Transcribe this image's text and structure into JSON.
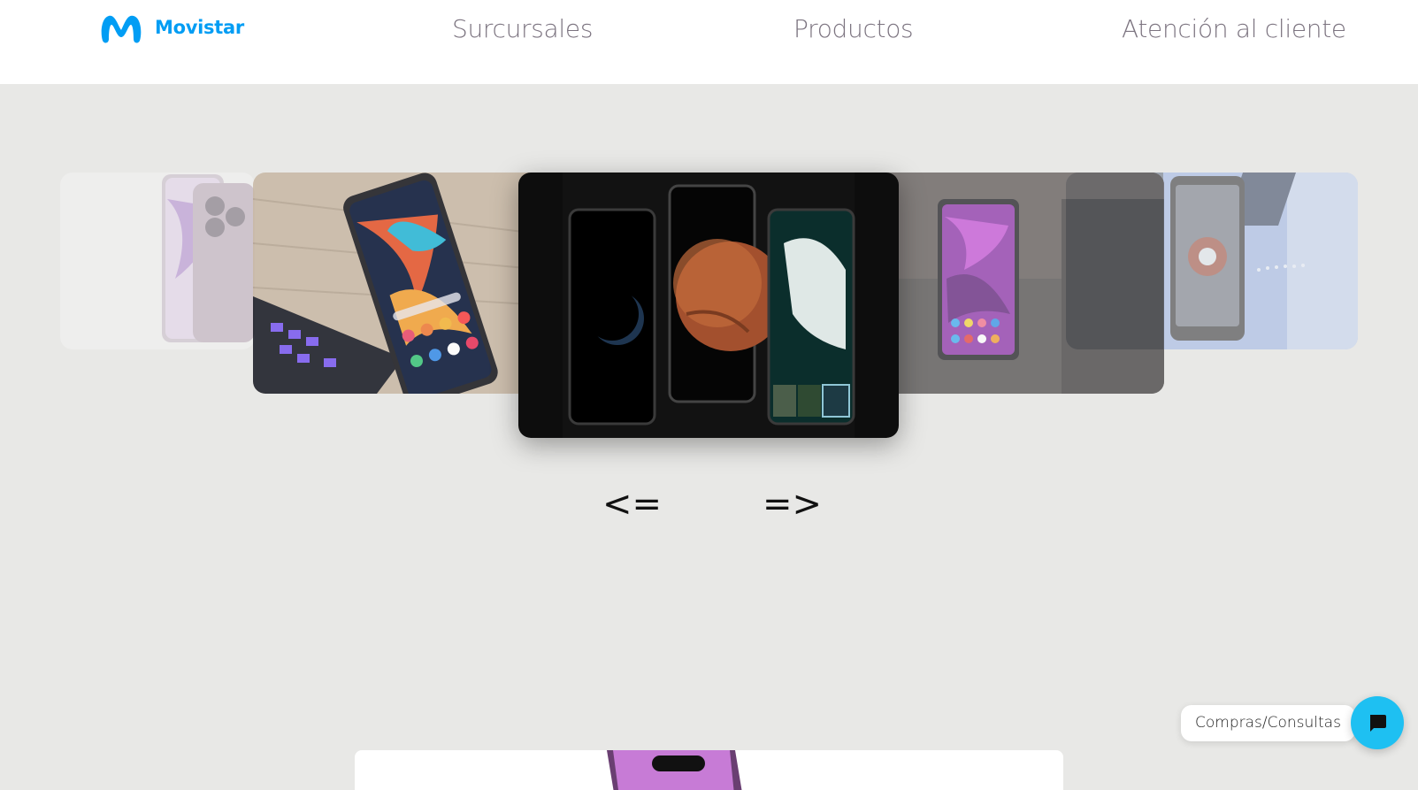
{
  "header": {
    "brand": "Movistar",
    "brand_color": "#019df4",
    "logo_icon": "movistar-m-icon",
    "nav": [
      {
        "label": "Surcursales"
      },
      {
        "label": "Productos"
      },
      {
        "label": "Atención al cliente"
      }
    ]
  },
  "carousel": {
    "slides": [
      {
        "name": "slide-iphone-purple",
        "icon": "phone-photo"
      },
      {
        "name": "slide-samsung-keyboard",
        "icon": "phone-photo"
      },
      {
        "name": "slide-xiaomi-mars",
        "icon": "phone-photo",
        "active": true
      },
      {
        "name": "slide-samsung-flip",
        "icon": "phone-photo"
      },
      {
        "name": "slide-moto-ironman",
        "icon": "phone-photo"
      }
    ],
    "prev_label": "<=",
    "next_label": "=>"
  },
  "chat": {
    "label": "Compras/Consultas",
    "icon": "chat-bubble-icon",
    "color": "#1ec0f2"
  }
}
